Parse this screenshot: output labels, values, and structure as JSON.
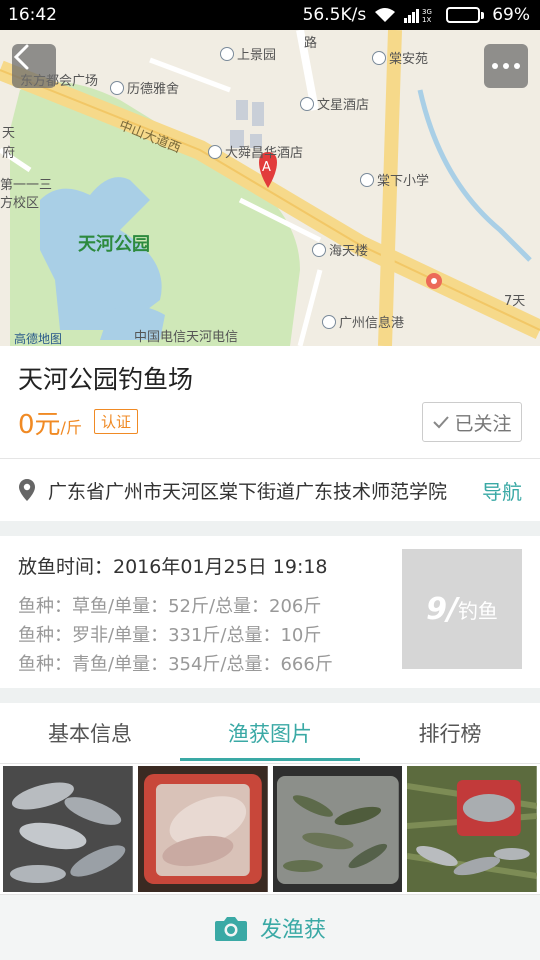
{
  "status_bar": {
    "time": "16:42",
    "network_speed": "56.5K/s",
    "battery": "69%",
    "battery_level": 0.69,
    "signal_small": "3G",
    "signal_small2": "1X"
  },
  "map": {
    "labels": {
      "shangjing": "上景园",
      "tangan": "棠安苑",
      "lide": "历德雅舍",
      "wenxing": "文星酒店",
      "zhongshan_road": "中山大道西",
      "dashun": "大舜昌华酒店",
      "tangxia_school": "棠下小学",
      "park": "天河公园",
      "haitian": "海天楼",
      "first_school": "第一一三",
      "school_area": "方校区",
      "dongfang": "东方都会广场",
      "telecom": "中国电信天河电信",
      "xinxigang": "广州信息港",
      "seven_eleven": "7天",
      "sky_left": "天",
      "fu": "府",
      "lu": "路",
      "gaode": "高德地图"
    },
    "marker": "A",
    "back_icon": "chevron-left-icon",
    "more_icon": "more-dots-icon"
  },
  "place": {
    "title": "天河公园钓鱼场",
    "price": "0元",
    "price_unit": "/斤",
    "certified_label": "认证",
    "follow_label": "已关注"
  },
  "address": {
    "text": "广东省广州市天河区棠下街道广东技术师范学院",
    "nav_label": "导航"
  },
  "stocking": {
    "time_label": "放鱼时间：",
    "time_value": "2016年01月25日 19:18",
    "species": [
      "鱼种：草鱼/单量：52斤/总量：206斤",
      "鱼种：罗非/单量：331斤/总量：10斤",
      "鱼种：青鱼/单量：354斤/总量：666斤"
    ],
    "logo_text_a": "9/",
    "logo_text_b": "钓鱼"
  },
  "tabs": [
    {
      "label": "基本信息",
      "active": false
    },
    {
      "label": "渔获图片",
      "active": true
    },
    {
      "label": "排行榜",
      "active": false
    }
  ],
  "bottom": {
    "post_label": "发渔获"
  },
  "colors": {
    "accent": "#3aa9a5",
    "price": "#f08a24"
  }
}
